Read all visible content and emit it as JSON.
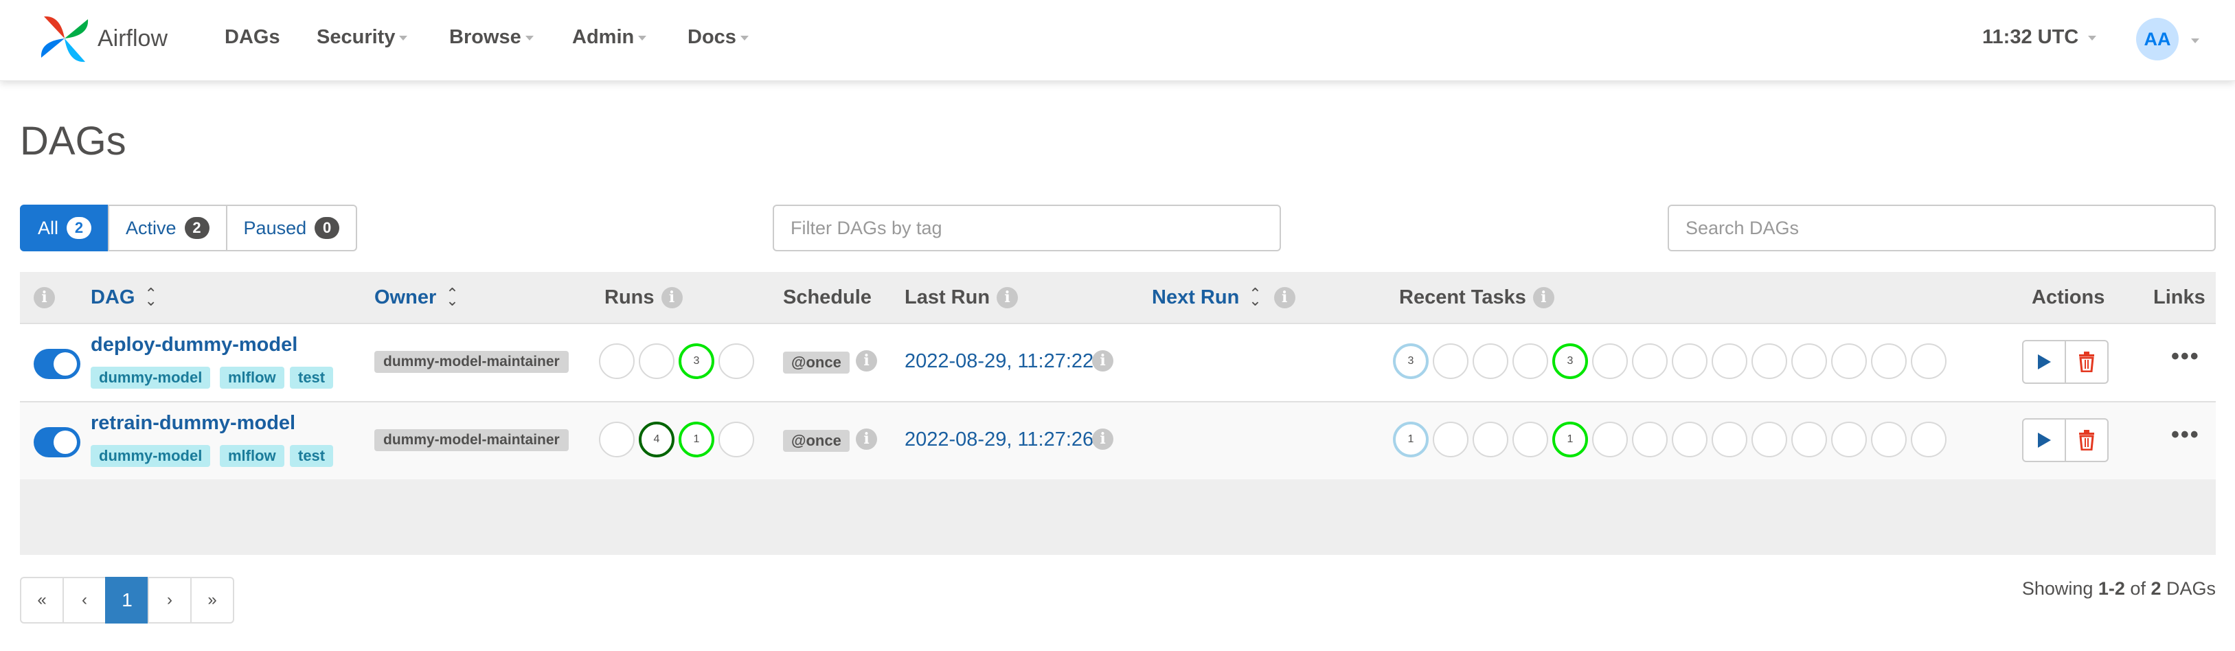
{
  "navbar": {
    "brand": "Airflow",
    "items": [
      {
        "label": "DAGs"
      },
      {
        "label": "Security"
      },
      {
        "label": "Browse"
      },
      {
        "label": "Admin"
      },
      {
        "label": "Docs"
      }
    ],
    "clock": "11:32 UTC",
    "avatar_initials": "AA"
  },
  "page": {
    "title": "DAGs"
  },
  "filters": {
    "all_label": "All",
    "all_count": "2",
    "active_label": "Active",
    "active_count": "2",
    "paused_label": "Paused",
    "paused_count": "0"
  },
  "tag_filter": {
    "placeholder": "Filter DAGs by tag"
  },
  "search": {
    "placeholder": "Search DAGs"
  },
  "table": {
    "headers": {
      "dag": "DAG",
      "owner": "Owner",
      "runs": "Runs",
      "schedule": "Schedule",
      "last_run": "Last Run",
      "next_run": "Next Run",
      "recent_tasks": "Recent Tasks",
      "actions": "Actions",
      "links": "Links"
    },
    "rows": [
      {
        "dag_id": "deploy-dummy-model",
        "tags": [
          "dummy-model",
          "mlflow",
          "test"
        ],
        "owner": "dummy-model-maintainer",
        "runs": [
          "",
          "",
          "3",
          ""
        ],
        "schedule": "@once",
        "last_run": "2022-08-29, 11:27:22",
        "recent_first": "3",
        "recent_success": "3",
        "paused": false
      },
      {
        "dag_id": "retrain-dummy-model",
        "tags": [
          "dummy-model",
          "mlflow",
          "test"
        ],
        "owner": "dummy-model-maintainer",
        "runs": [
          "",
          "4",
          "1",
          ""
        ],
        "schedule": "@once",
        "last_run": "2022-08-29, 11:27:26",
        "recent_first": "1",
        "recent_success": "1",
        "paused": false
      }
    ]
  },
  "pagination": {
    "first": "«",
    "prev": "‹",
    "current": "1",
    "next": "›",
    "last": "»",
    "showing_prefix": "Showing ",
    "showing_range": "1-2",
    "showing_of": " of ",
    "showing_total": "2",
    "showing_suffix": " DAGs"
  },
  "colors": {
    "primary": "#1a76d2",
    "link": "#1a5fa0",
    "success": "#00e600",
    "running": "#006400",
    "queued": "#a6d3ea",
    "delete": "#e43921",
    "tag_bg": "#b8ecf2"
  }
}
